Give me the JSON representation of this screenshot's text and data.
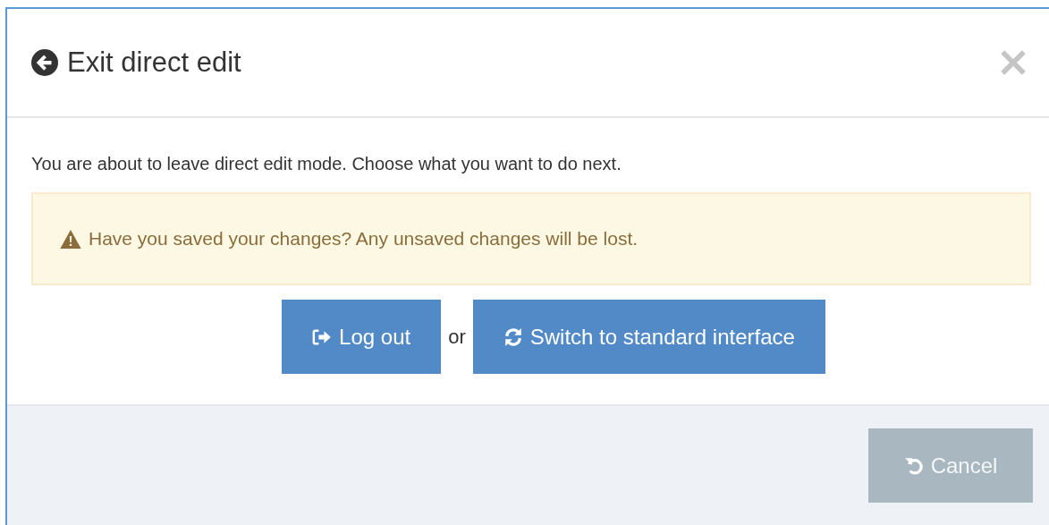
{
  "dialog": {
    "title": "Exit direct edit"
  },
  "message": "You are about to leave direct edit mode. Choose what you want to do next.",
  "warning": "Have you saved your changes? Any unsaved changes will be lost.",
  "actions": [
    {
      "kind": "logout",
      "label": "Log out"
    },
    {
      "kind": "separator",
      "label": "or"
    },
    {
      "kind": "switch",
      "label": "Switch to standard interface"
    }
  ],
  "footer": {
    "cancel": {
      "label": "Cancel",
      "disabled": true
    }
  }
}
